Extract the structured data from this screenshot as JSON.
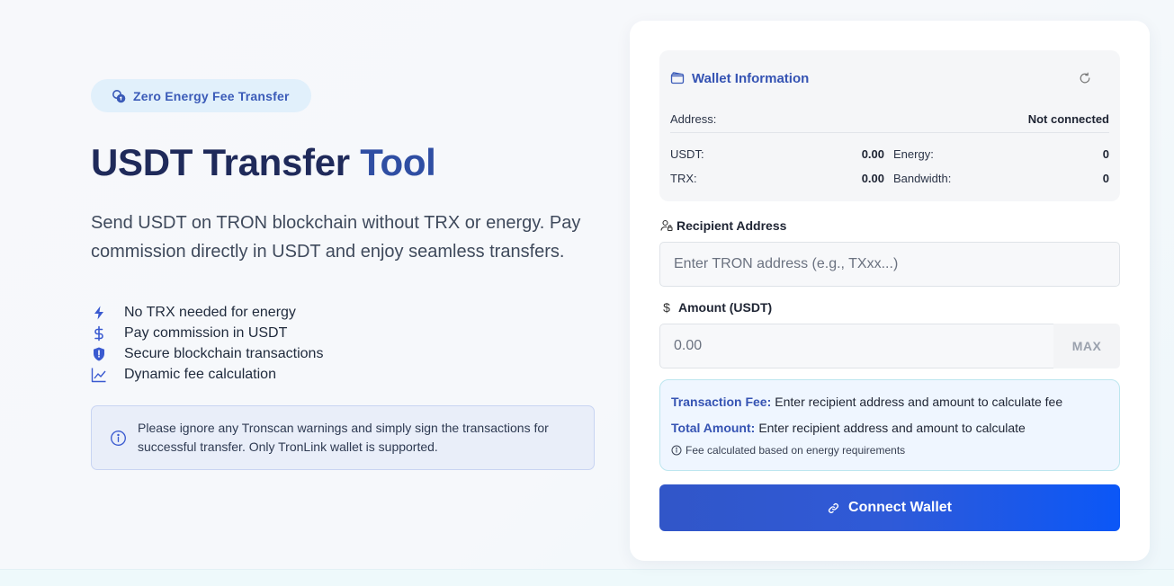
{
  "hero": {
    "badge": "Zero Energy Fee Transfer",
    "title_main": "USDT Transfer",
    "title_accent": "Tool",
    "description": "Send USDT on TRON blockchain without TRX or energy. Pay commission directly in USDT and enjoy seamless transfers.",
    "features": [
      {
        "icon": "lightning-icon",
        "label": "No TRX needed for energy"
      },
      {
        "icon": "dollar-icon",
        "label": "Pay commission in USDT"
      },
      {
        "icon": "shield-icon",
        "label": "Secure blockchain transactions"
      },
      {
        "icon": "chart-line-icon",
        "label": "Dynamic fee calculation"
      }
    ],
    "notice": "Please ignore any Tronscan warnings and simply sign the transactions for successful transfer. Only TronLink wallet is supported."
  },
  "wallet": {
    "title": "Wallet Information",
    "address_label": "Address:",
    "address_value": "Not connected",
    "usdt_label": "USDT:",
    "usdt_value": "0.00",
    "trx_label": "TRX:",
    "trx_value": "0.00",
    "energy_label": "Energy:",
    "energy_value": "0",
    "bandwidth_label": "Bandwidth:",
    "bandwidth_value": "0"
  },
  "form": {
    "recipient_label": "Recipient Address",
    "recipient_placeholder": "Enter TRON address (e.g., TXxx...)",
    "recipient_value": "",
    "amount_label": "Amount (USDT)",
    "amount_placeholder": "0.00",
    "amount_value": "",
    "max_label": "MAX"
  },
  "fee": {
    "fee_key": "Transaction Fee:",
    "fee_text": "Enter recipient address and amount to calculate fee",
    "total_key": "Total Amount:",
    "total_text": "Enter recipient address and amount to calculate",
    "note": "Fee calculated based on energy requirements"
  },
  "actions": {
    "connect_label": "Connect Wallet"
  },
  "colors": {
    "primary": "#3553b3",
    "button_gradient_start": "#3156c8",
    "button_gradient_end": "#0b57f7",
    "badge_bg": "#e1f0fb",
    "notice_bg": "#e9eef9",
    "fee_bg": "#eff6ff"
  }
}
